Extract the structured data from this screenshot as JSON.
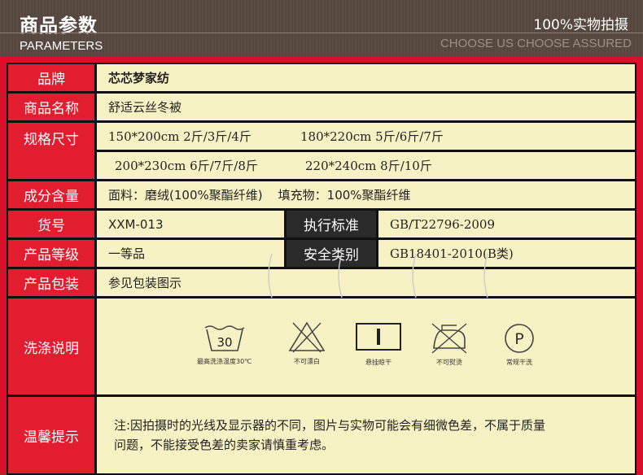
{
  "header": {
    "title": "商品参数",
    "subtitle": "PARAMETERS",
    "right_top": "100%实物拍摄",
    "right_bottom": "CHOOSE US CHOOSE ASSURED"
  },
  "rows": {
    "brand_label": "品牌",
    "brand_value": "芯芯梦家纺",
    "name_label": "商品名称",
    "name_value": "舒适云丝冬被",
    "size_label": "规格尺寸",
    "size_1a": "150*200cm 2斤/3斤/4斤",
    "size_1b": "180*220cm 5斤/6斤/7斤",
    "size_2a": "200*230cm 6斤/7斤/8斤",
    "size_2b": "220*240cm 8斤/10斤",
    "composition_label": "成分含量",
    "composition_value": "面料：磨绒(100%聚酯纤维)    填充物：100%聚酯纤维",
    "sku_label": "货号",
    "sku_value": "XXM-013",
    "standard_label": "执行标准",
    "standard_value": "GB/T22796-2009",
    "grade_label": "产品等级",
    "grade_value": "一等品",
    "safety_label": "安全类别",
    "safety_value": "GB18401-2010(B类)",
    "package_label": "产品包装",
    "package_value": "参见包装图示",
    "wash_label": "洗涤说明",
    "tips_label": "温馨提示",
    "tips_line1": "注:因拍摄时的光线及显示器的不同，图片与实物可能会有细微色差，不属于质量",
    "tips_line2": "问题，不能接受色差的卖家请慎重考虑。"
  },
  "wash_icons": [
    {
      "icon": "wash-30-icon",
      "text": "30",
      "caption": "最高洗涤温度30℃"
    },
    {
      "icon": "no-bleach-icon",
      "caption": "不可漂白"
    },
    {
      "icon": "hang-dry-icon",
      "caption": "悬挂晾干"
    },
    {
      "icon": "no-iron-icon",
      "caption": "不可熨烫"
    },
    {
      "icon": "dry-clean-icon",
      "text": "P",
      "caption": "常规干洗"
    }
  ],
  "colors": {
    "red": "#e31d30",
    "cream": "#f7f2c4",
    "dark": "#2a2a2a"
  }
}
